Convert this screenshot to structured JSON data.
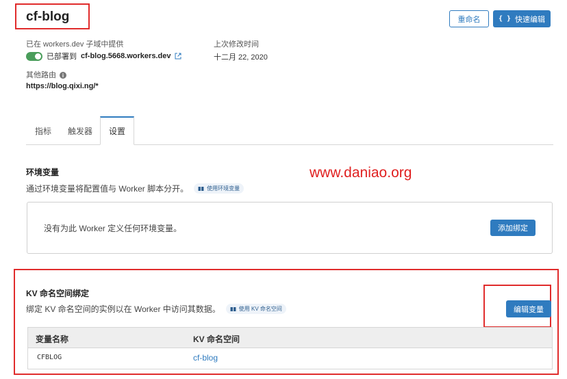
{
  "worker": {
    "name": "cf-blog",
    "rename_label": "重命名",
    "quick_edit_label": "快速编辑",
    "quick_edit_icon": "{ }"
  },
  "workers_dev": {
    "label": "已在 workers.dev 子域中提供",
    "deployed_prefix": "已部署到",
    "url": "cf-blog.5668.workers.dev",
    "toggle_on": true
  },
  "last_modified": {
    "label": "上次修改时间",
    "value": "十二月 22, 2020"
  },
  "other_routes": {
    "label": "其他路由",
    "value": "https://blog.qixi.ng/*"
  },
  "tabs": [
    {
      "label": "指标",
      "active": false
    },
    {
      "label": "触发器",
      "active": false
    },
    {
      "label": "设置",
      "active": true
    }
  ],
  "env": {
    "title": "环境变量",
    "desc": "通过环境变量将配置值与 Worker 脚本分开。",
    "doc_link": "使用环境变量",
    "empty_text": "没有为此 Worker 定义任何环境变量。",
    "add_button": "添加绑定"
  },
  "watermark": "www.daniao.org",
  "kv": {
    "title": "KV 命名空间绑定",
    "desc": "绑定 KV 命名空间的实例以在 Worker 中访问其数据。",
    "doc_link": "使用 KV 命名空间",
    "edit_button": "编辑变量",
    "columns": [
      "变量名称",
      "KV 命名空间"
    ],
    "rows": [
      {
        "variable": "CFBLOG",
        "namespace": "cf-blog"
      }
    ]
  },
  "colors": {
    "accent": "#2f7bbf",
    "highlight": "#e02b2b",
    "toggle": "#4a9d5b"
  }
}
